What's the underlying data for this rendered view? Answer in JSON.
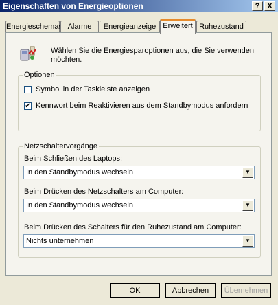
{
  "window": {
    "title": "Eigenschaften von Energieoptionen"
  },
  "title_buttons": {
    "help": "?",
    "close": "X"
  },
  "tabs": [
    {
      "label": "Energieschemas"
    },
    {
      "label": "Alarme"
    },
    {
      "label": "Energieanzeige"
    },
    {
      "label": "Erweitert"
    },
    {
      "label": "Ruhezustand"
    }
  ],
  "active_tab": "Erweitert",
  "intro": {
    "text": "Wählen Sie die Energiesparoptionen aus, die Sie verwenden möchten."
  },
  "options": {
    "legend": "Optionen",
    "items": [
      {
        "label": "Symbol in der Taskleiste anzeigen",
        "checked": false
      },
      {
        "label": "Kennwort beim Reaktivieren aus dem Standbymodus anfordern",
        "checked": true
      }
    ]
  },
  "power_buttons": {
    "legend": "Netzschaltervorgänge",
    "lid": {
      "label": "Beim Schließen des Laptops:",
      "value": "In den Standbymodus wechseln"
    },
    "power": {
      "label": "Beim Drücken des Netzschalters am Computer:",
      "value": "In den Standbymodus wechseln"
    },
    "sleep": {
      "label": "Beim Drücken des Schalters für den Ruhezustand am Computer:",
      "value": "Nichts unternehmen"
    }
  },
  "buttons": {
    "ok": "OK",
    "cancel": "Abbrechen",
    "apply": "Übernehmen"
  }
}
